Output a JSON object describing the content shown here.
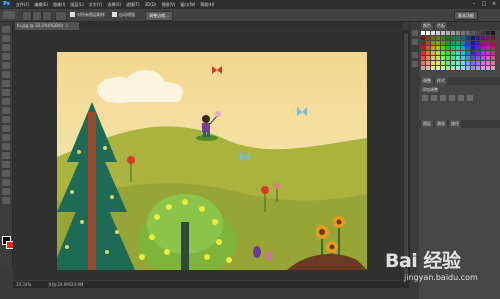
{
  "app": {
    "logo": "Ps"
  },
  "menubar": {
    "items": [
      "文件(F)",
      "编辑(E)",
      "图像(I)",
      "图层(L)",
      "文字(Y)",
      "选择(S)",
      "滤镜(T)",
      "3D(D)",
      "视图(V)",
      "窗口(W)",
      "帮助(H)"
    ],
    "window_buttons": [
      "–",
      "□",
      "×"
    ]
  },
  "optionsbar": {
    "auto_enhance": "自动增强",
    "refine_edge": "调整边缘...",
    "sample_all": "对所有图层取样",
    "workspace_button": "基本功能"
  },
  "document": {
    "tab_title": "fu.jpg @ 33.3%(RGB/8)",
    "close": "×"
  },
  "statusbar": {
    "zoom": "33.33%",
    "doc_info": "文档:24.9M/24.9M"
  },
  "panels": {
    "color_tabs": [
      "颜色",
      "色板"
    ],
    "adjust_tabs": [
      "调整",
      "样式"
    ],
    "adjust_label": "添加调整",
    "layer_tabs": [
      "图层",
      "通道",
      "路径"
    ]
  },
  "colors": {
    "fg": "#000000",
    "bg": "#e8281f",
    "sky": "#f4e0a0",
    "hill": "#a3b23b"
  },
  "watermark": {
    "text": "Bai 经验",
    "sub": "jingyan.baidu.com"
  }
}
